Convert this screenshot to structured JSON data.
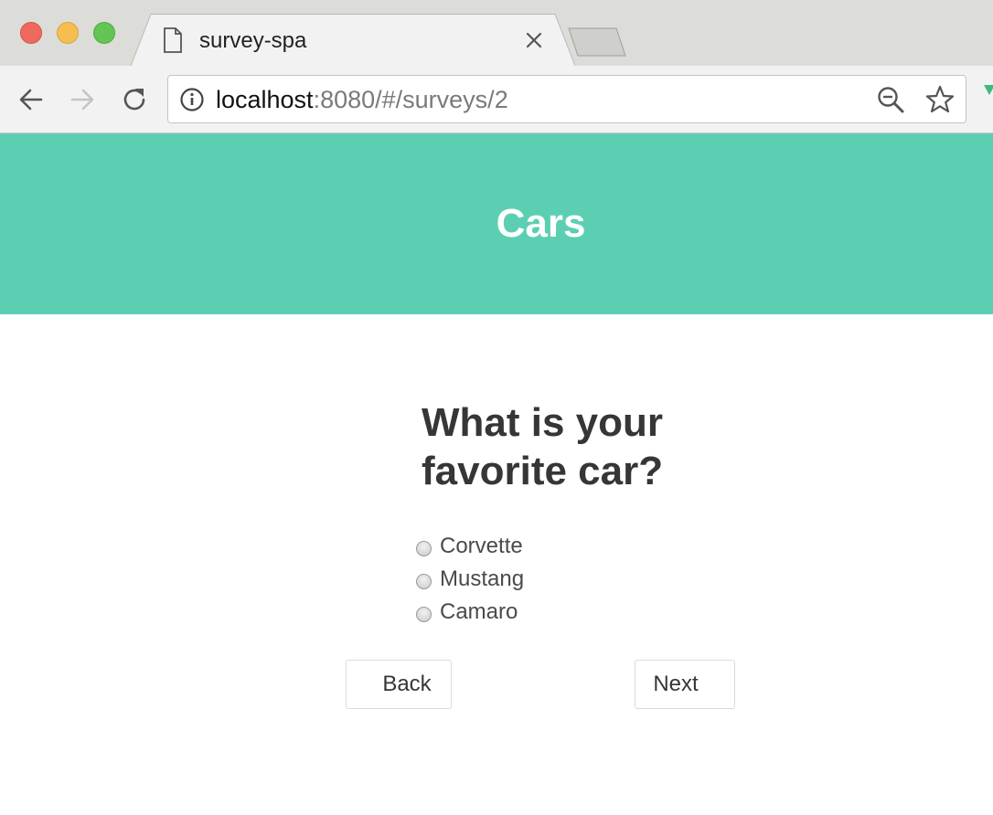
{
  "browser": {
    "tab": {
      "title": "survey-spa",
      "favicon": "document-icon"
    },
    "address_bar": {
      "host": "localhost",
      "path": ":8080/#/surveys/2"
    },
    "icons": [
      "back-arrow-icon",
      "forward-arrow-icon",
      "reload-icon",
      "info-icon",
      "zoom-out-icon",
      "star-icon",
      "close-icon"
    ]
  },
  "survey": {
    "name": "Cars",
    "question": "What is your favorite car?",
    "choices": [
      {
        "label": "Corvette",
        "selected": false
      },
      {
        "label": "Mustang",
        "selected": false
      },
      {
        "label": "Camaro",
        "selected": false
      }
    ],
    "buttons": {
      "back": "Back",
      "next": "Next"
    }
  },
  "colors": {
    "hero": "#5ccfb3",
    "text": "#363636"
  }
}
